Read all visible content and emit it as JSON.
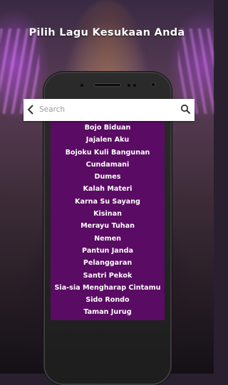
{
  "header": {
    "title": "Pilih Lagu Kesukaan Anda"
  },
  "search": {
    "placeholder": "Search",
    "value": ""
  },
  "songs": [
    "Bojo Biduan",
    "Jajalen Aku",
    "Bojoku Kuli Bangunan",
    "Cundamani",
    "Dumes",
    "Kalah Materi",
    "Karna Su Sayang",
    "Kisinan",
    "Merayu Tuhan",
    "Nemen",
    "Pantun Janda",
    "Pelanggaran",
    "Santri Pekok",
    "Sia-sia Mengharap Cintamu",
    "Sido Rondo",
    "Taman Jurug"
  ],
  "icons": {
    "back": "chevron-left-icon",
    "search": "search-icon"
  },
  "colors": {
    "list_background": "#5a0b63",
    "text": "#ffffff",
    "search_bar": "#ffffff"
  }
}
